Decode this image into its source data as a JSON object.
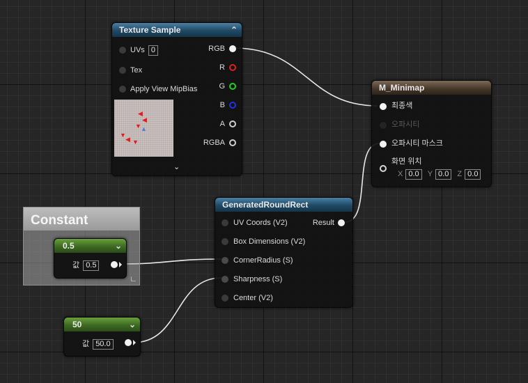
{
  "texture_sample": {
    "title": "Texture Sample",
    "inputs": [
      {
        "label": "UVs",
        "value": "0"
      },
      {
        "label": "Tex"
      },
      {
        "label": "Apply View MipBias"
      }
    ],
    "outputs": [
      "RGB",
      "R",
      "G",
      "B",
      "A",
      "RGBA"
    ],
    "collapse_icon": "chevron-up-icon",
    "expand_icon": "chevron-down-icon"
  },
  "material_result": {
    "title": "M_Minimap",
    "inputs": [
      {
        "label": "최종색",
        "enabled": true
      },
      {
        "label": "오파시티",
        "enabled": false
      },
      {
        "label": "오파시티 마스크",
        "enabled": true
      },
      {
        "label": "화면 위치",
        "enabled": true
      }
    ],
    "screen_position": {
      "x_label": "X",
      "x": "0.0",
      "y_label": "Y",
      "y": "0.0",
      "z_label": "Z",
      "z": "0.0"
    }
  },
  "round_rect": {
    "title": "GeneratedRoundRect",
    "inputs": [
      "UV Coords (V2)",
      "Box Dimensions (V2)",
      "CornerRadius (S)",
      "Sharpness (S)",
      "Center (V2)"
    ],
    "output": "Result"
  },
  "comment_box": {
    "title": "Constant"
  },
  "constant_a": {
    "title": "0.5",
    "value_label": "값",
    "value": "0.5"
  },
  "constant_b": {
    "title": "50",
    "value_label": "값",
    "value": "50.0"
  },
  "colors": {
    "graph_background": "#262626",
    "texture_header": "#1e4a66",
    "material_header": "#433528",
    "constant_header": "#3d6a22",
    "pin_r": "#e02020",
    "pin_g": "#1fd21f",
    "pin_b": "#2230e8",
    "wire": "#e8e8e8"
  }
}
